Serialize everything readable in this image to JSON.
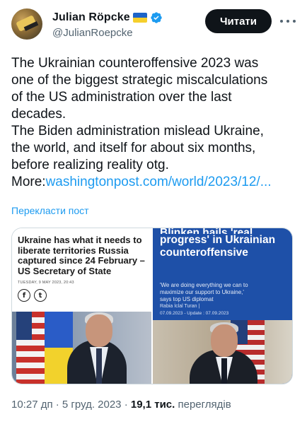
{
  "author": {
    "display_name": "Julian Röpcke",
    "handle": "@JulianRoepcke"
  },
  "follow_button": "Читати",
  "tweet": {
    "lines": [
      "The Ukrainian counteroffensive 2023 was",
      "one of the biggest strategic miscalculations",
      "of the US administration over the last",
      "decades.",
      "The Biden administration mislead Ukraine,",
      "the world, and itself for about six months,",
      "before realizing reality otg."
    ],
    "more_label": "More:",
    "link_text": "washingtonpost.com/world/2023/12/..."
  },
  "translate_label": "Перекласти пост",
  "media": {
    "left": {
      "headline_lines": [
        "Ukraine has what it needs to",
        "liberate territories Russia",
        "captured since 24 February –",
        "US Secretary of State"
      ],
      "date": "TUESDAY, 9 MAY 2023, 20:43",
      "social_icons": [
        "f",
        "t"
      ]
    },
    "right": {
      "headline_clipped": "Blinken hails 'real",
      "headline_lines": [
        "progress' in Ukrainian",
        "counteroffensive"
      ],
      "subtitle_lines": [
        "'We are doing everything we can to",
        "maximize our support to Ukraine,'",
        "says top US diplomat"
      ],
      "author": "Rabia İclal Turan  |",
      "meta": "07.09.2023 - Update : 07.09.2023"
    }
  },
  "meta": {
    "time_date": "10:27 дп · 5 груд. 2023 ·",
    "views_count": "19,1 тис.",
    "views_label": "переглядів"
  },
  "colors": {
    "accent": "#1d9bf0",
    "verified": "#1d9bf0",
    "card_blue": "#1e50a8"
  }
}
